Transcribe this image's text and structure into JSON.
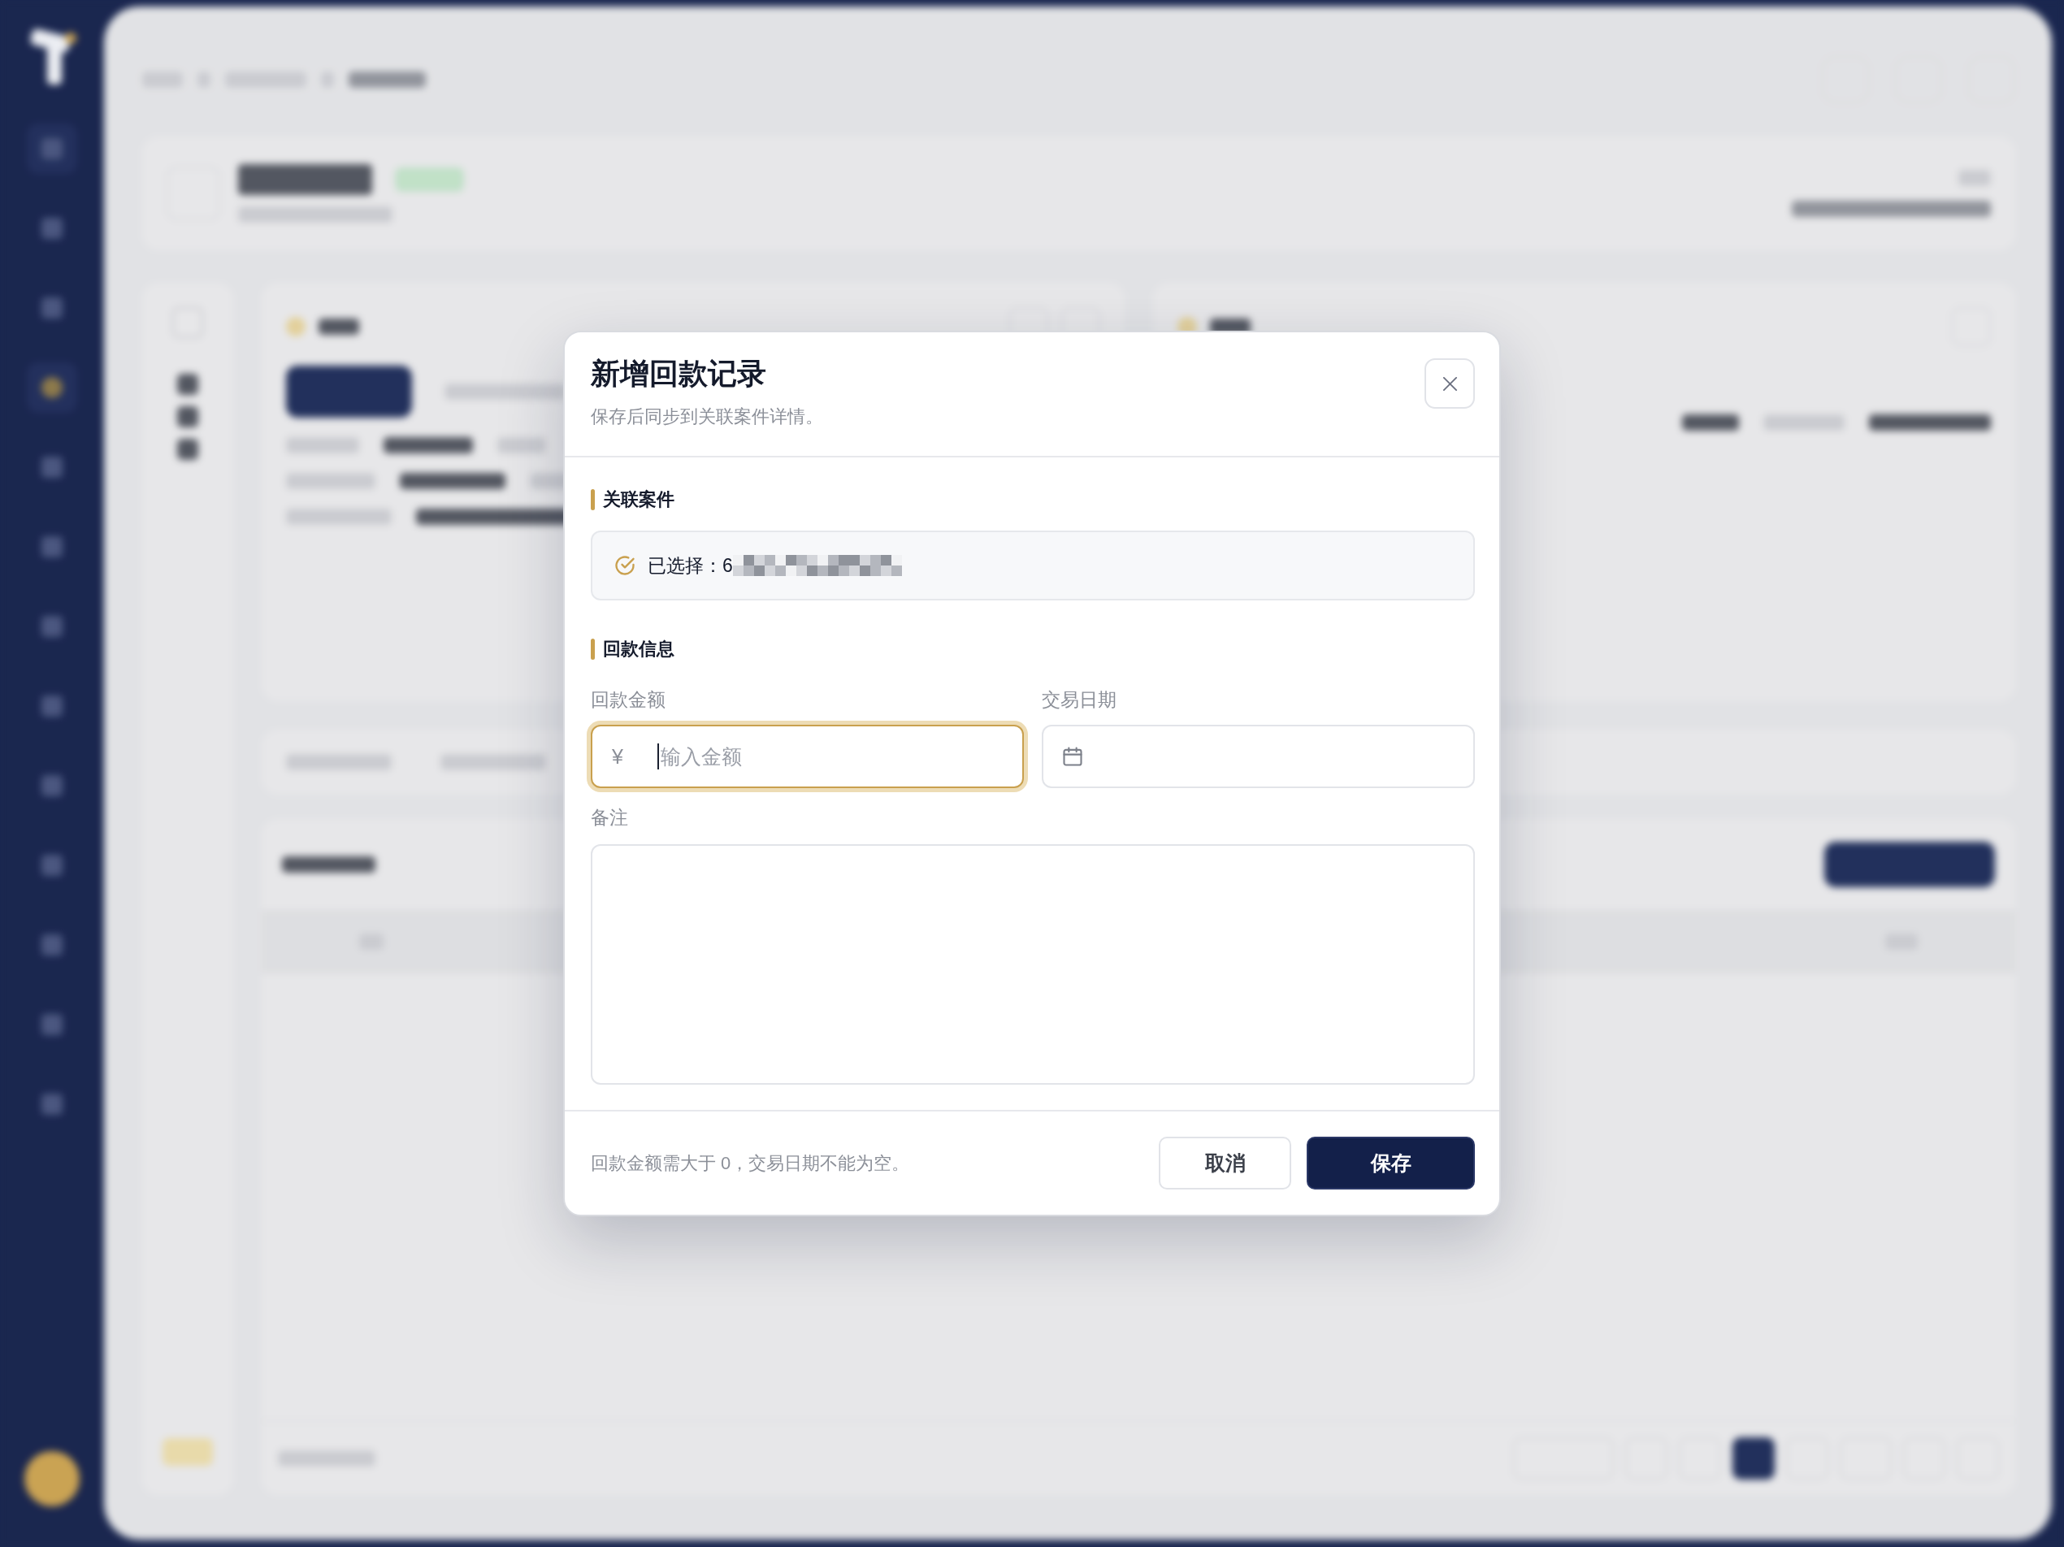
{
  "dialog": {
    "title": "新增回款记录",
    "subtitle": "保存后同步到关联案件详情。"
  },
  "linked_case": {
    "heading": "关联案件",
    "selection": "已选择：6",
    "redacted": true
  },
  "payment_info": {
    "heading": "回款信息",
    "fields": [
      {
        "kind": "amount",
        "label": "回款金额",
        "prefix": "¥",
        "placeholder": "输入金额",
        "focused": true
      },
      {
        "kind": "date",
        "label": "交易日期",
        "focused": false
      },
      {
        "kind": "textarea",
        "label": "备注",
        "focused": false
      }
    ]
  },
  "footer": {
    "hint": "回款金额需大于 0，交易日期不能为空。",
    "buttons": [
      {
        "label": "取消",
        "kind": "secondary"
      },
      {
        "label": "保存",
        "kind": "primary"
      }
    ]
  }
}
